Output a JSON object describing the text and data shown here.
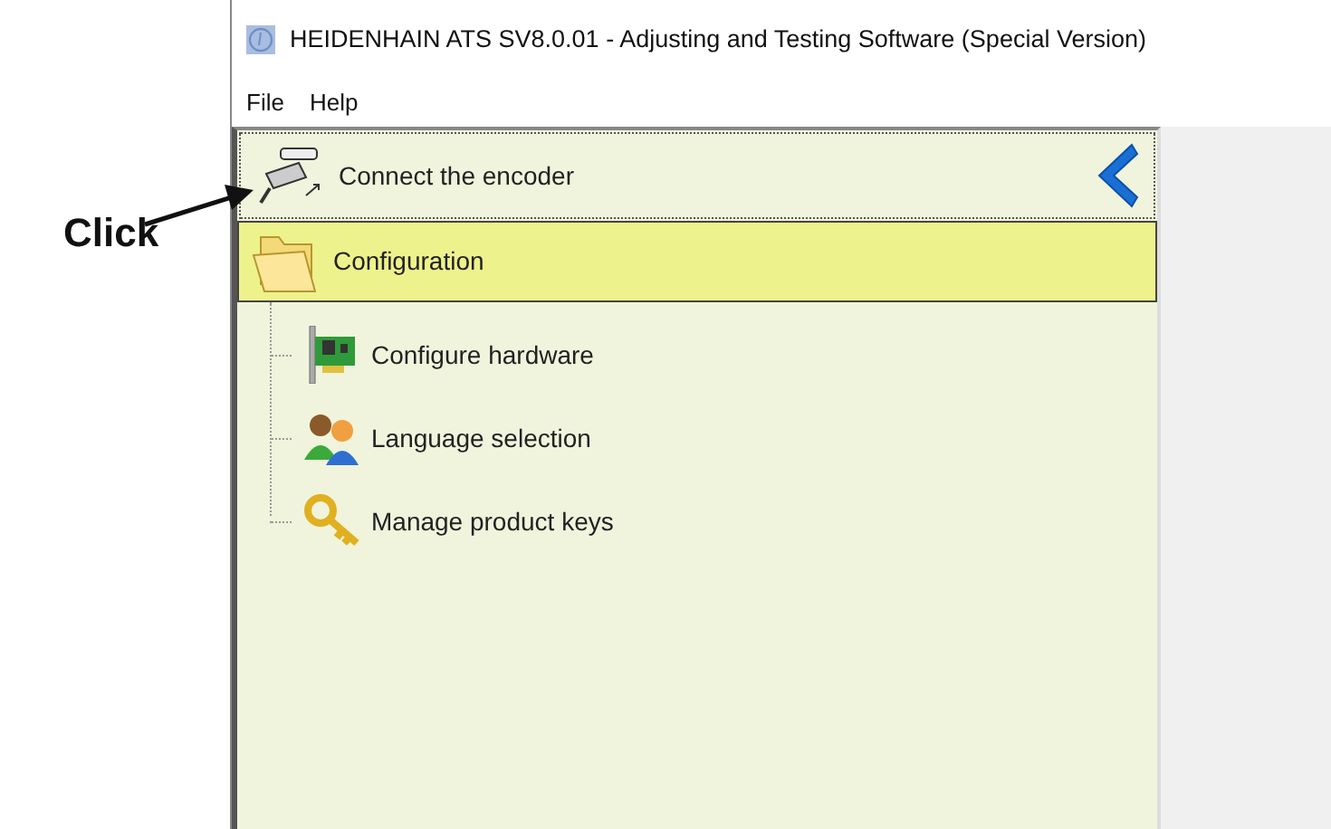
{
  "annotation": {
    "text": "Click"
  },
  "window": {
    "title": "HEIDENHAIN ATS SV8.0.01 - Adjusting and Testing Software (Special Version)"
  },
  "menu": [
    {
      "label": "File"
    },
    {
      "label": "Help"
    }
  ],
  "panel": {
    "header": {
      "label": "Connect the encoder"
    },
    "group": {
      "label": "Configuration",
      "selected": true,
      "expanded": true,
      "children": [
        {
          "label": "Configure hardware",
          "kind": "hardware",
          "selected": false
        },
        {
          "label": "Language selection",
          "kind": "language",
          "selected": false
        },
        {
          "label": "Manage product keys",
          "kind": "keys",
          "selected": false
        }
      ]
    }
  }
}
